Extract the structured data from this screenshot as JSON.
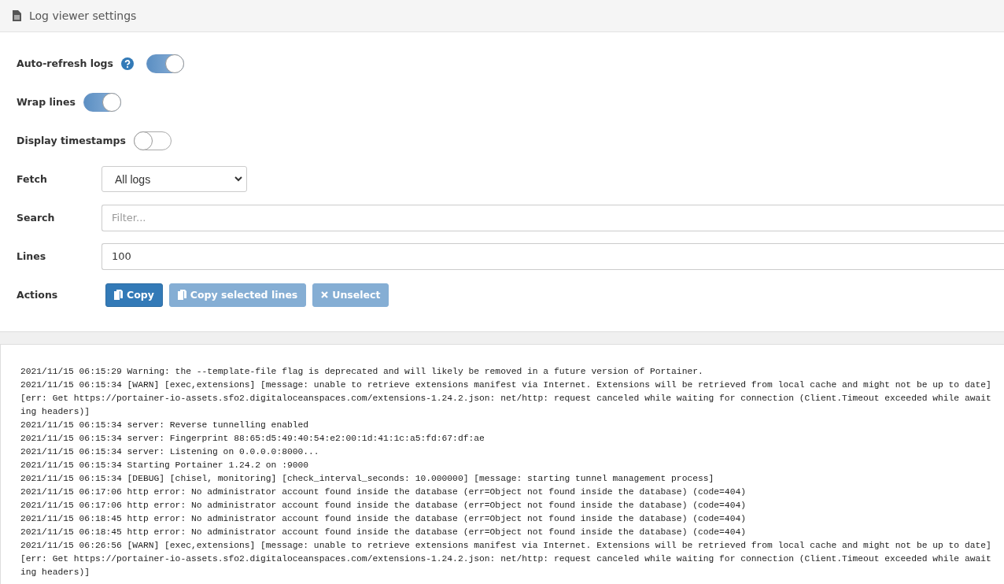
{
  "header": {
    "title": "Log viewer settings"
  },
  "settings": [
    {
      "kind": "toggle",
      "label": "Auto-refresh logs",
      "help": true,
      "on": true
    },
    {
      "kind": "toggle",
      "label": "Wrap lines",
      "help": false,
      "on": true
    },
    {
      "kind": "toggle",
      "label": "Display timestamps",
      "help": false,
      "on": false
    },
    {
      "kind": "select",
      "label": "Fetch",
      "value": "All logs"
    },
    {
      "kind": "input",
      "label": "Search",
      "placeholder": "Filter..."
    },
    {
      "kind": "input",
      "label": "Lines",
      "value": "100"
    },
    {
      "kind": "actions",
      "label": "Actions",
      "buttons": [
        {
          "label": "Copy",
          "kind": "copy",
          "disabled": false
        },
        {
          "label": "Copy selected lines",
          "kind": "copy",
          "disabled": true
        },
        {
          "label": "Unselect",
          "kind": "clear",
          "disabled": true
        }
      ]
    }
  ],
  "log_lines": [
    "2021/11/15 06:15:29 Warning: the --template-file flag is deprecated and will likely be removed in a future version of Portainer.",
    "2021/11/15 06:15:34 [WARN] [exec,extensions] [message: unable to retrieve extensions manifest via Internet. Extensions will be retrieved from local cache and might not be up to date] [err: Get https://portainer-io-assets.sfo2.digitaloceanspaces.com/extensions-1.24.2.json: net/http: request canceled while waiting for connection (Client.Timeout exceeded while awaiting headers)]",
    "2021/11/15 06:15:34 server: Reverse tunnelling enabled",
    "2021/11/15 06:15:34 server: Fingerprint 88:65:d5:49:40:54:e2:00:1d:41:1c:a5:fd:67:df:ae",
    "2021/11/15 06:15:34 server: Listening on 0.0.0.0:8000...",
    "2021/11/15 06:15:34 Starting Portainer 1.24.2 on :9000",
    "2021/11/15 06:15:34 [DEBUG] [chisel, monitoring] [check_interval_seconds: 10.000000] [message: starting tunnel management process]",
    "2021/11/15 06:17:06 http error: No administrator account found inside the database (err=Object not found inside the database) (code=404)",
    "2021/11/15 06:17:06 http error: No administrator account found inside the database (err=Object not found inside the database) (code=404)",
    "2021/11/15 06:18:45 http error: No administrator account found inside the database (err=Object not found inside the database) (code=404)",
    "2021/11/15 06:18:45 http error: No administrator account found inside the database (err=Object not found inside the database) (code=404)",
    "2021/11/15 06:26:56 [WARN] [exec,extensions] [message: unable to retrieve extensions manifest via Internet. Extensions will be retrieved from local cache and might not be up to date] [err: Get https://portainer-io-assets.sfo2.digitaloceanspaces.com/extensions-1.24.2.json: net/http: request canceled while waiting for connection (Client.Timeout exceeded while awaiting headers)]"
  ]
}
